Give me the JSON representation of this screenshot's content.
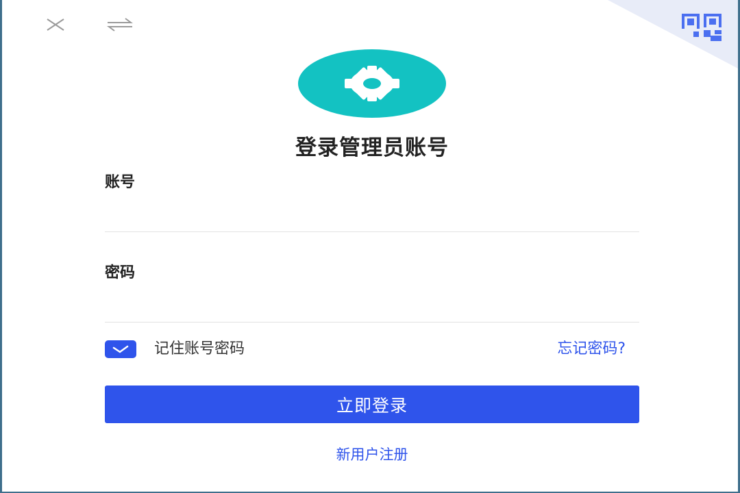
{
  "window": {
    "close_icon": "close-icon",
    "switch_icon": "swap-arrows-icon",
    "qr_icon": "qr-code-icon"
  },
  "logo": {
    "icon": "gear-icon",
    "color": "#13c2c2"
  },
  "title": "登录管理员账号",
  "account": {
    "label": "账号",
    "value": "",
    "placeholder": ""
  },
  "password": {
    "label": "密码",
    "value": "",
    "placeholder": ""
  },
  "remember": {
    "label": "记住账号密码",
    "checked": true
  },
  "forgot_link": "忘记密码?",
  "login_button": "立即登录",
  "register_link": "新用户注册",
  "colors": {
    "primary": "#2f54eb",
    "accent": "#13c2c2"
  }
}
